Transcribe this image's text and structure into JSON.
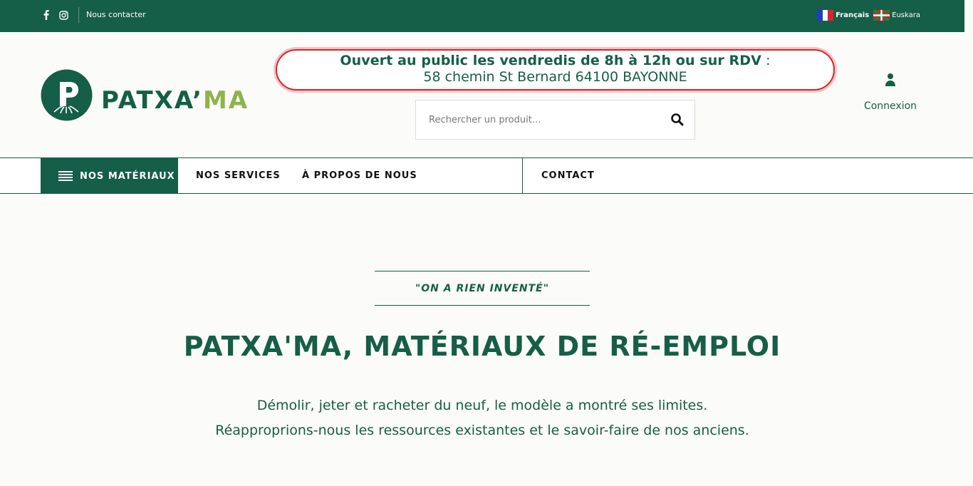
{
  "topbar": {
    "icons": {
      "facebook": "facebook-icon",
      "instagram": "instagram-icon"
    },
    "contact_label": "Nous contacter",
    "languages": [
      {
        "label": "Français",
        "flag": "france-flag-icon",
        "active": true
      },
      {
        "label": "Euskara",
        "flag": "basque-flag-icon",
        "active": false
      }
    ]
  },
  "logo": {
    "text_main": "PATXA’",
    "text_accent": "MA"
  },
  "announcement": {
    "line1": "Ouvert au public les vendredis de 8h à 12h ou sur RDV",
    "line1_colon": " :",
    "line2": "58 chemin St Bernard 64100 BAYONNE"
  },
  "search": {
    "placeholder": "Rechercher un produit...",
    "icon": "search-icon"
  },
  "account": {
    "label": "Connexion",
    "icon": "user-icon"
  },
  "nav": {
    "materials_label": "NOS MATÉRIAUX",
    "items": [
      {
        "label": "NOS SERVICES"
      },
      {
        "label": "À PROPOS DE NOUS"
      },
      {
        "label": "CONTACT"
      }
    ]
  },
  "hero": {
    "tagline": "\"ON A RIEN INVENTÉ\"",
    "title": "PATXA'MA, MATÉRIAUX DE RÉ-EMPLOI",
    "text_line1": "Démolir, jeter et racheter du neuf, le modèle a montré ses limites.",
    "text_line2": "Réapproprions-nous les ressources existantes et le savoir-faire de nos anciens."
  },
  "colors": {
    "brand_green": "#155e47",
    "accent_green": "#8fb34a",
    "announce_border": "#d0282f"
  }
}
